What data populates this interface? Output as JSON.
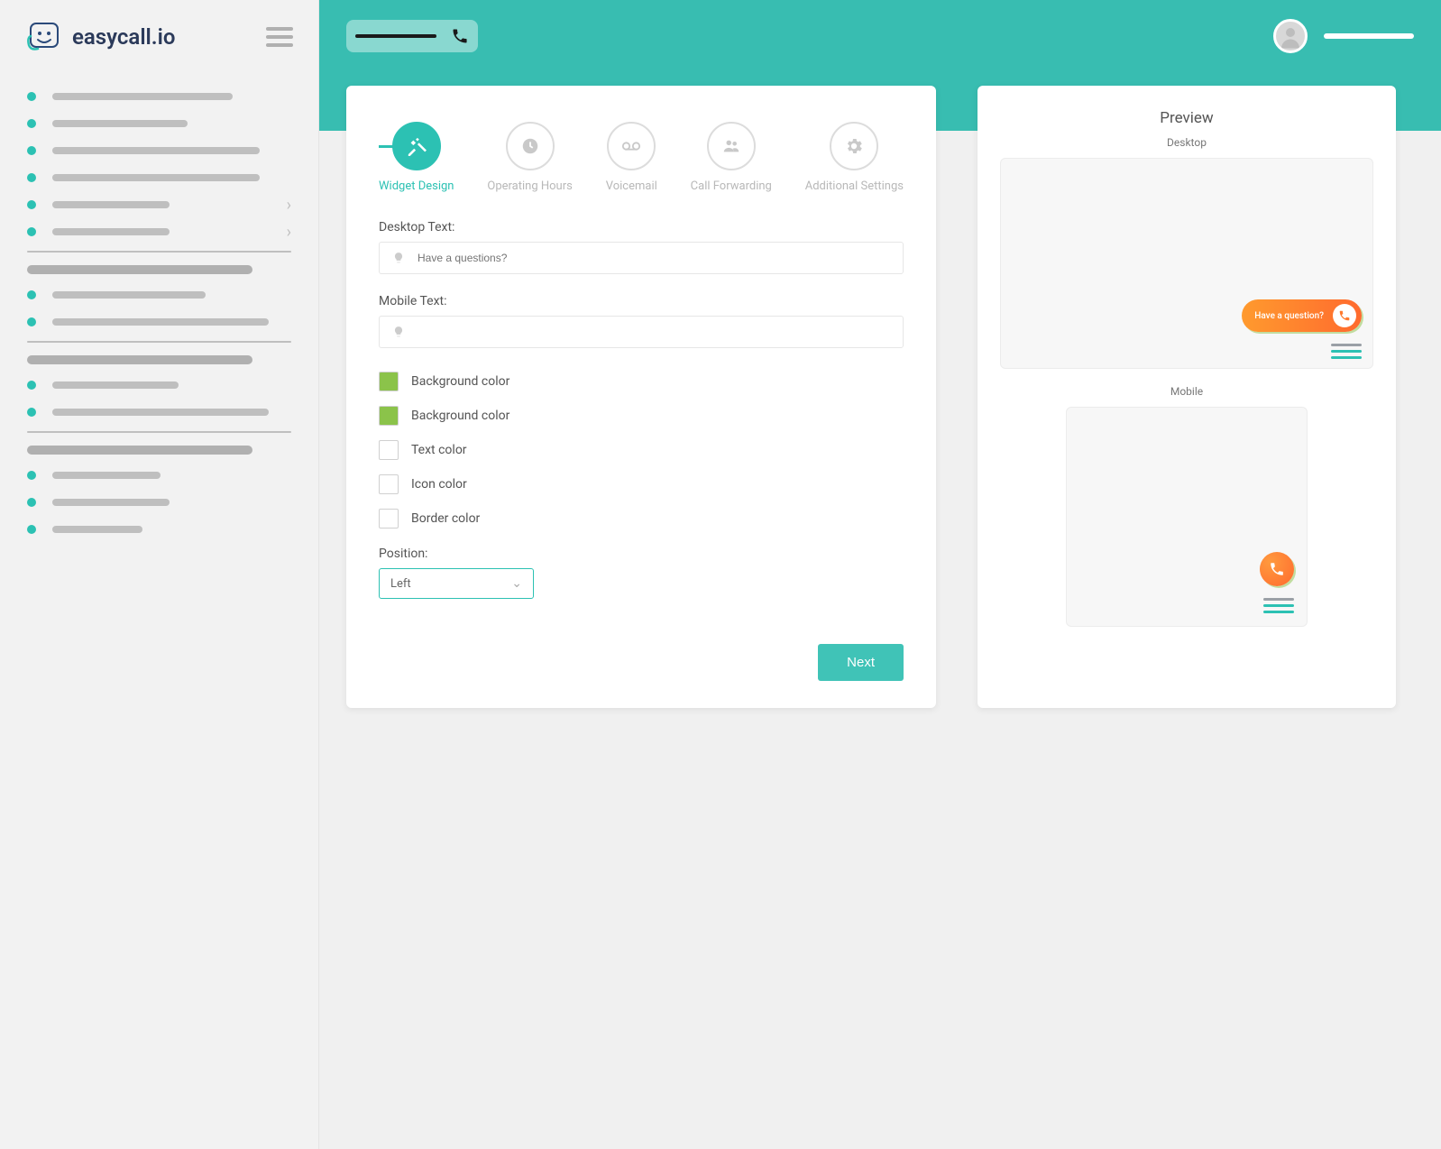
{
  "brand": {
    "name": "easycall.io"
  },
  "stepper": {
    "steps": [
      {
        "label": "Widget Design",
        "active": true,
        "icon": "tools"
      },
      {
        "label": "Operating Hours",
        "active": false,
        "icon": "clock"
      },
      {
        "label": "Voicemail",
        "active": false,
        "icon": "voicemail"
      },
      {
        "label": "Call Forwarding",
        "active": false,
        "icon": "group"
      },
      {
        "label": "Additional Settings",
        "active": false,
        "icon": "gear"
      }
    ]
  },
  "form": {
    "desktopTextLabel": "Desktop Text:",
    "desktopTextPlaceholder": "Have a questions?",
    "desktopTextValue": "",
    "mobileTextLabel": "Mobile Text:",
    "mobileTextValue": "",
    "colors": [
      {
        "label": "Background color",
        "value": "#8BC34A"
      },
      {
        "label": "Background color",
        "value": "#8BC34A"
      },
      {
        "label": "Text color",
        "value": "#FFFFFF"
      },
      {
        "label": "Icon color",
        "value": "#FFFFFF"
      },
      {
        "label": "Border color",
        "value": "#FFFFFF"
      }
    ],
    "positionLabel": "Position:",
    "positionValue": "Left",
    "nextButton": "Next"
  },
  "preview": {
    "title": "Preview",
    "desktopLabel": "Desktop",
    "mobileLabel": "Mobile",
    "widgetText": "Have a question?"
  }
}
